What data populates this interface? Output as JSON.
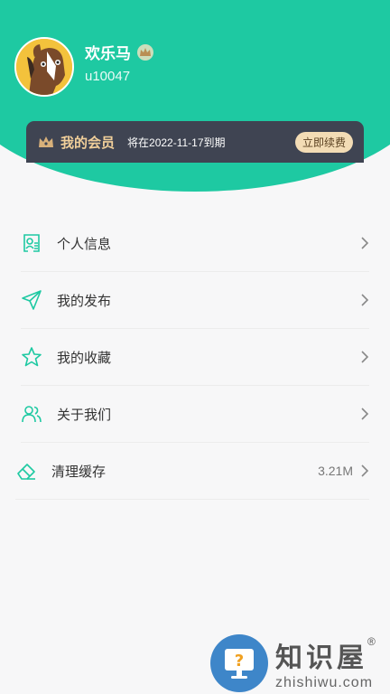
{
  "profile": {
    "username": "欢乐马",
    "user_id": "u10047"
  },
  "vip": {
    "title": "我的会员",
    "expire_text": "将在2022-11-17到期",
    "renew_label": "立即续费"
  },
  "menu": {
    "items": [
      {
        "label": "个人信息",
        "icon": "id-card-icon"
      },
      {
        "label": "我的发布",
        "icon": "paper-plane-icon"
      },
      {
        "label": "我的收藏",
        "icon": "star-icon"
      },
      {
        "label": "关于我们",
        "icon": "users-icon"
      }
    ],
    "cache": {
      "label": "清理缓存",
      "value": "3.21M",
      "icon": "eraser-icon"
    }
  },
  "watermark": {
    "brand": "知识屋",
    "registered": "®",
    "domain": "zhishiwu.com"
  },
  "colors": {
    "accent": "#1ec9a2",
    "vip_bg": "#3f4452",
    "vip_gold": "#f1cf9a"
  }
}
